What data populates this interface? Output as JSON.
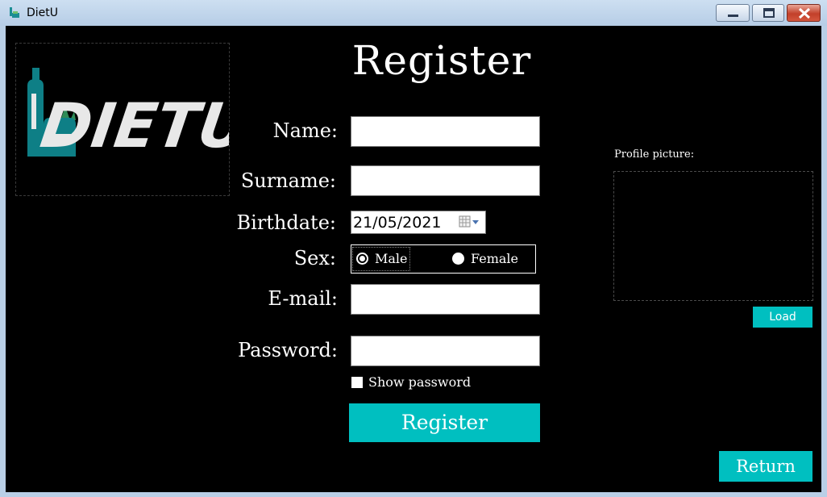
{
  "window": {
    "title": "DietU"
  },
  "logo": {
    "text": "DIETU"
  },
  "form": {
    "heading": "Register",
    "name_label": "Name:",
    "name_value": "",
    "surname_label": "Surname:",
    "surname_value": "",
    "birthdate_label": "Birthdate:",
    "birthdate_value": "21/05/2021",
    "sex_label": "Sex:",
    "sex_options": [
      "Male",
      "Female"
    ],
    "sex_selected": "Male",
    "email_label": "E-mail:",
    "email_value": "",
    "password_label": "Password:",
    "password_value": "",
    "show_password_label": "Show password",
    "show_password_checked": false,
    "register_button": "Register"
  },
  "profile": {
    "label": "Profile picture:",
    "load_button": "Load"
  },
  "return_button": "Return",
  "colors": {
    "accent": "#00bfc0",
    "background": "#000000",
    "logo_teal": "#0e7f86"
  }
}
